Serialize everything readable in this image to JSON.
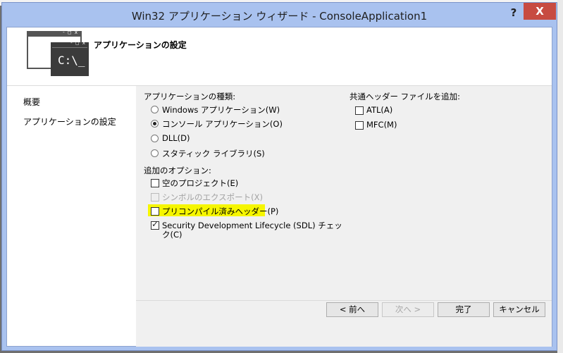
{
  "window": {
    "title": "Win32 アプリケーション ウィザード - ConsoleApplication1",
    "help_label": "?",
    "close_label": "X"
  },
  "header": {
    "title": "アプリケーションの設定",
    "icon_prompt": "C:\\_"
  },
  "sidebar": {
    "items": [
      {
        "label": "概要"
      },
      {
        "label": "アプリケーションの設定"
      }
    ]
  },
  "app_type": {
    "label": "アプリケーションの種類:",
    "options": [
      {
        "label": "Windows アプリケーション(W)",
        "selected": false
      },
      {
        "label": "コンソール アプリケーション(O)",
        "selected": true
      },
      {
        "label": "DLL(D)",
        "selected": false
      },
      {
        "label": "スタティック ライブラリ(S)",
        "selected": false
      }
    ]
  },
  "additional_options": {
    "label": "追加のオプション:",
    "items": [
      {
        "label": "空のプロジェクト(E)",
        "checked": false,
        "enabled": true
      },
      {
        "label": "シンボルのエクスポート(X)",
        "checked": false,
        "enabled": false
      },
      {
        "label": "プリコンパイル済みヘッダー(P)",
        "checked": false,
        "enabled": true,
        "highlight": "#f6f600"
      },
      {
        "label_line1": "Security Development Lifecycle (SDL) チェッ",
        "label_line2": "ク(C)",
        "checked": true,
        "enabled": true
      }
    ]
  },
  "common_headers": {
    "label": "共通ヘッダー ファイルを追加:",
    "items": [
      {
        "label": "ATL(A)",
        "checked": false
      },
      {
        "label": "MFC(M)",
        "checked": false
      }
    ]
  },
  "footer": {
    "back_label": "< 前へ",
    "next_label": "次へ >",
    "finish_label": "完了",
    "cancel_label": "キャンセル"
  }
}
